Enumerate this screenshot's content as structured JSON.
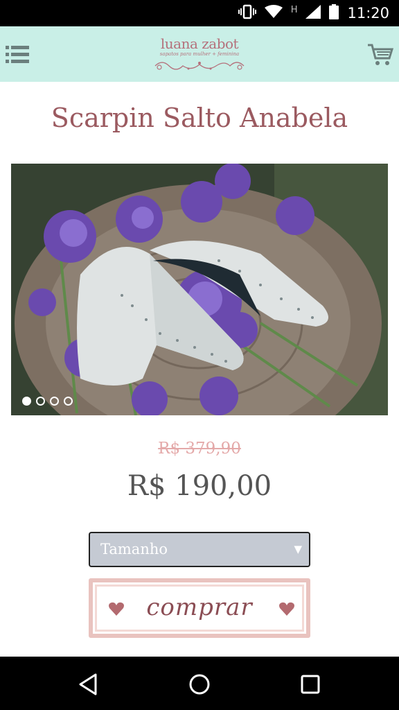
{
  "status_bar": {
    "time": "11:20",
    "network_letter": "H",
    "icons": [
      "vibrate-icon",
      "wifi-icon",
      "cell-signal-icon",
      "battery-icon"
    ]
  },
  "header": {
    "brand": "luana zabot",
    "tagline": "sapatos para mulher + feminina",
    "icons": [
      "menu-icon",
      "cart-icon"
    ],
    "background_color": "#c9efe7"
  },
  "product": {
    "title": "Scarpin Salto Anabela",
    "old_price": "R$ 379,90",
    "price": "R$ 190,00",
    "carousel": {
      "slides": 4,
      "active_slide": 1
    }
  },
  "size_select": {
    "selected": "Tamanho"
  },
  "buy_button": {
    "label": "comprar"
  },
  "nav_bar": {
    "icons": [
      "back-icon",
      "home-icon",
      "recents-icon"
    ]
  },
  "colors": {
    "title": "#9b5a60",
    "old_price": "#e4a9a9",
    "price": "#555555",
    "select_bg": "#c5cad3"
  }
}
